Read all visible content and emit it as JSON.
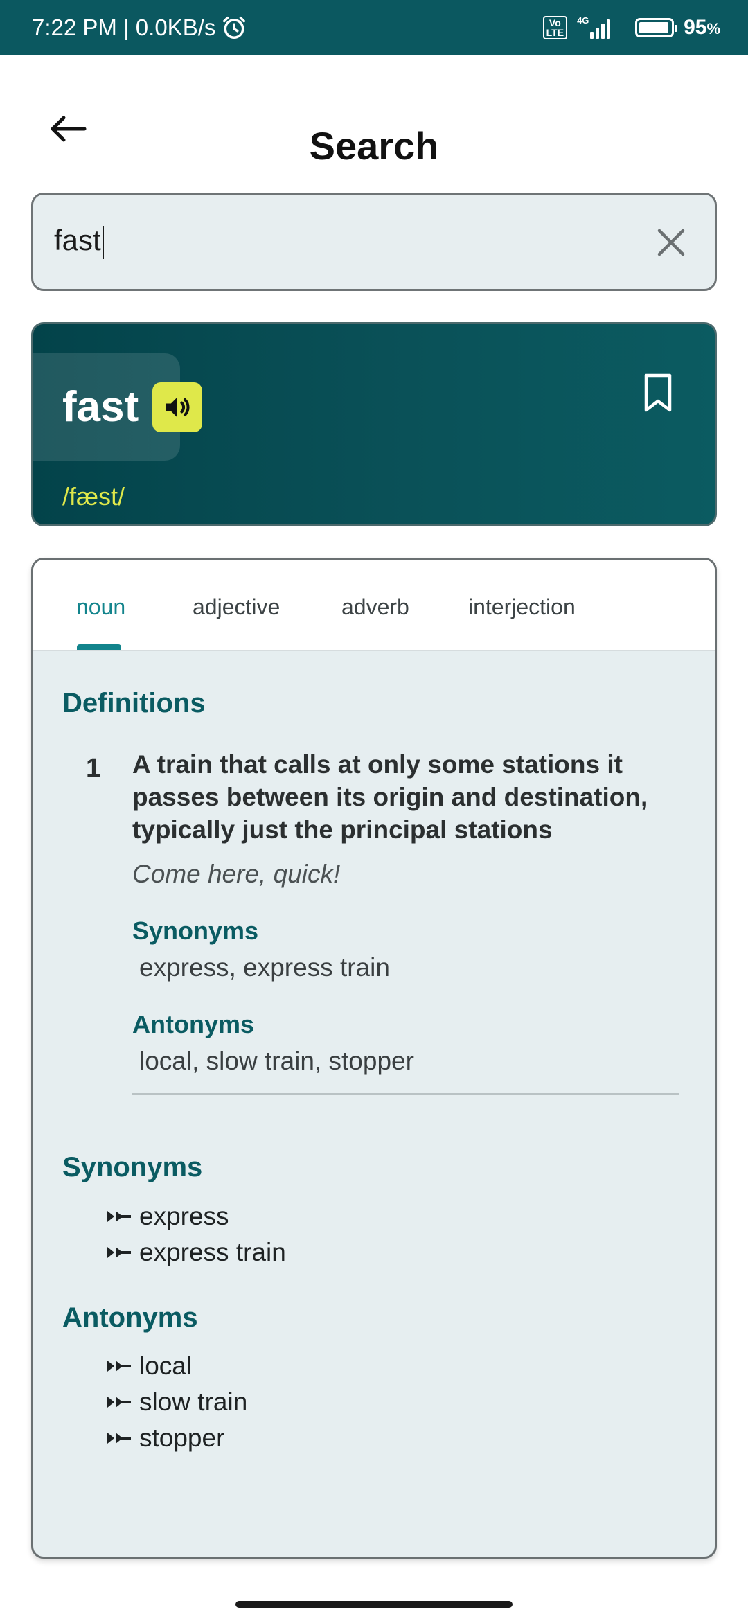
{
  "status_bar": {
    "time_speed": "7:22 PM | 0.0KB/s",
    "volte": "Vo\nLTE",
    "network": "4G",
    "battery_pct": "95",
    "battery_unit": "%",
    "battery_level": 0.95
  },
  "header": {
    "title": "Search"
  },
  "search": {
    "value": "fast",
    "placeholder": "Search"
  },
  "word_card": {
    "word": "fast",
    "phonetic": "/fæst/"
  },
  "tabs": [
    {
      "label": "noun",
      "active": true
    },
    {
      "label": "adjective",
      "active": false
    },
    {
      "label": "adverb",
      "active": false
    },
    {
      "label": "interjection",
      "active": false
    }
  ],
  "definitions": {
    "heading": "Definitions",
    "items": [
      {
        "number": "1",
        "text": "A train that calls at only some stations it passes between its origin and destination, typically just the principal stations",
        "example": "Come here, quick!",
        "synonyms_label": "Synonyms",
        "synonyms": [
          "express",
          "express train"
        ],
        "antonyms_label": "Antonyms",
        "antonyms": [
          "local",
          "slow train",
          "stopper"
        ]
      }
    ]
  },
  "synonyms": {
    "heading": "Synonyms",
    "items": [
      "express",
      "express train"
    ]
  },
  "antonyms": {
    "heading": "Antonyms",
    "items": [
      "local",
      "slow train",
      "stopper"
    ]
  },
  "colors": {
    "primary": "#0b5860",
    "accent": "#12848c",
    "highlight": "#dfe84a"
  }
}
